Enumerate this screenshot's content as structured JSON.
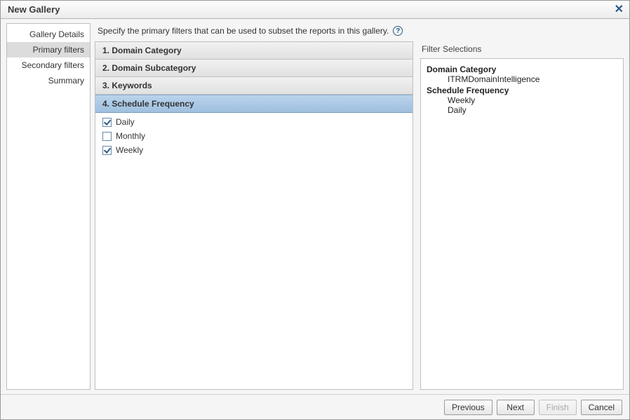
{
  "title": "New Gallery",
  "sidebar": {
    "items": [
      {
        "label": "Gallery Details",
        "active": false
      },
      {
        "label": "Primary filters",
        "active": true
      },
      {
        "label": "Secondary filters",
        "active": false
      },
      {
        "label": "Summary",
        "active": false
      }
    ]
  },
  "instructions": "Specify the primary filters that can be used to subset the reports in this gallery.",
  "filters": {
    "items": [
      {
        "label": "1. Domain Category",
        "expanded": false
      },
      {
        "label": "2. Domain Subcategory",
        "expanded": false
      },
      {
        "label": "3. Keywords",
        "expanded": false
      },
      {
        "label": "4. Schedule Frequency",
        "expanded": true
      }
    ],
    "schedule_options": [
      {
        "label": "Daily",
        "checked": true
      },
      {
        "label": "Monthly",
        "checked": false
      },
      {
        "label": "Weekly",
        "checked": true
      }
    ]
  },
  "selections": {
    "title": "Filter Selections",
    "groups": [
      {
        "name": "Domain Category",
        "values": [
          "ITRMDomainIntelligence"
        ]
      },
      {
        "name": "Schedule Frequency",
        "values": [
          "Weekly",
          "Daily"
        ]
      }
    ]
  },
  "buttons": {
    "previous": "Previous",
    "next": "Next",
    "finish": "Finish",
    "cancel": "Cancel"
  }
}
